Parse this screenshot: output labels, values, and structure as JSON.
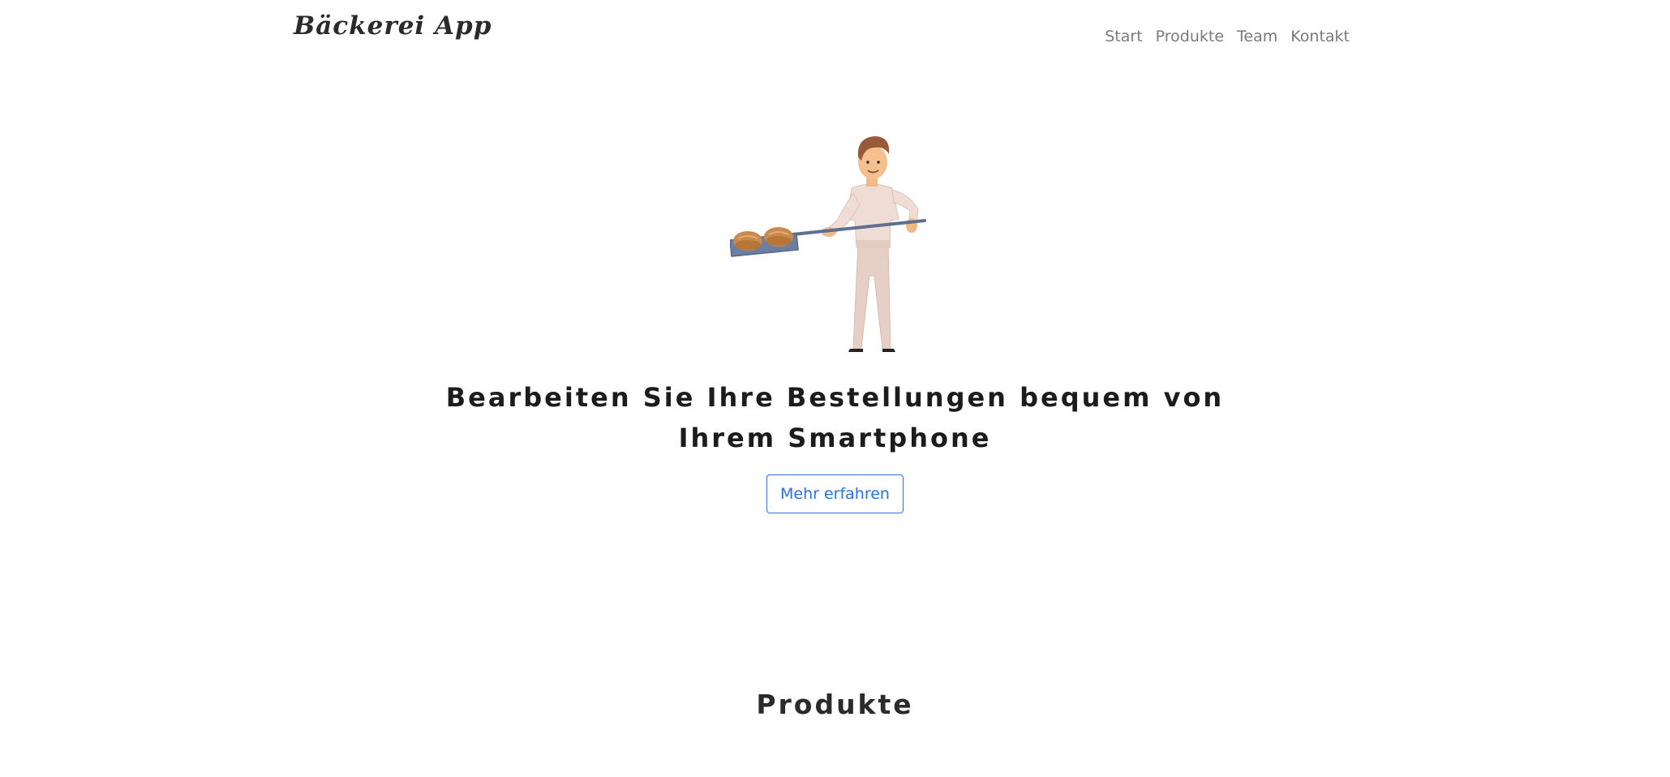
{
  "navbar": {
    "brand": "Bäckerei App",
    "links": [
      {
        "label": "Start"
      },
      {
        "label": "Produkte"
      },
      {
        "label": "Team"
      },
      {
        "label": "Kontakt"
      }
    ]
  },
  "hero": {
    "illustration": "baker-with-bread-peel-illustration",
    "heading": "Bearbeiten Sie Ihre Bestellungen bequem von Ihrem Smartphone",
    "button_label": "Mehr erfahren"
  },
  "products_section": {
    "title": "Produkte"
  },
  "colors": {
    "accent": "#2d6fdb",
    "text_dark": "#1c1c1c",
    "nav_text": "#7a7a7a"
  }
}
